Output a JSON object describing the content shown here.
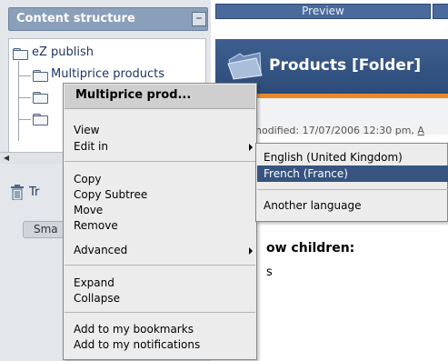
{
  "sidebar": {
    "title": "Content structure",
    "collapse_symbol": "–",
    "tree": {
      "root": "eZ publish",
      "child": "Multiprice products"
    },
    "trash_text": "Tr",
    "small_button": "Sma"
  },
  "main": {
    "preview_tab": "Preview",
    "page_title": "Products [Folder]",
    "modified": "nodified: 17/07/2006 12:30 pm,",
    "modified_suffix": "A",
    "show_children": "ow children:",
    "s_text": "s"
  },
  "context_menu": {
    "header": "Multiprice prod...",
    "items": {
      "view": "View",
      "edit_in": "Edit in",
      "copy": "Copy",
      "copy_subtree": "Copy Subtree",
      "move": "Move",
      "remove": "Remove",
      "advanced": "Advanced",
      "expand": "Expand",
      "collapse": "Collapse",
      "add_bookmarks": "Add to my bookmarks",
      "add_notifications": "Add to my notifications"
    }
  },
  "submenu": {
    "english": "English (United Kingdom)",
    "french": "French (France)",
    "another": "Another language"
  },
  "colors": {
    "header_blue": "#2b4a78",
    "accent_orange": "#e78b2a",
    "selection": "#36547f"
  }
}
